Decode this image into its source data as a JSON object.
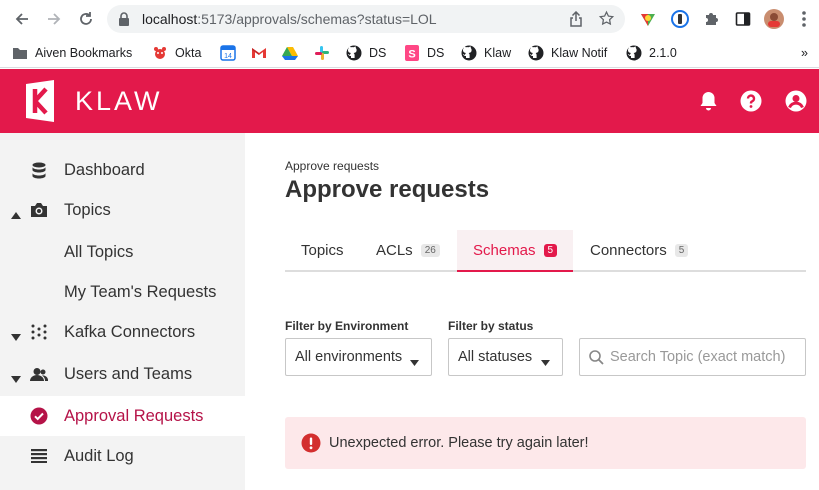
{
  "browser": {
    "url_host": "localhost",
    "url_rest": ":5173/approvals/schemas?status=LOL"
  },
  "bookmarks": [
    {
      "label": "Aiven Bookmarks",
      "icon": "folder-icon"
    },
    {
      "label": "Okta",
      "icon": "okta-icon"
    },
    {
      "label": "",
      "icon": "calendar-icon"
    },
    {
      "label": "",
      "icon": "gmail-icon"
    },
    {
      "label": "",
      "icon": "drive-icon"
    },
    {
      "label": "",
      "icon": "slack-icon"
    },
    {
      "label": "DS",
      "icon": "github-icon"
    },
    {
      "label": "DS",
      "icon": "storybook-icon"
    },
    {
      "label": "Klaw",
      "icon": "github-icon"
    },
    {
      "label": "Klaw Notif",
      "icon": "github-icon"
    },
    {
      "label": "2.1.0",
      "icon": "github-icon"
    }
  ],
  "bookmarks_more": "»",
  "header": {
    "logo_text": "KLAW",
    "brand_color": "#e3194b"
  },
  "sidebar": {
    "items": [
      {
        "label": "Dashboard",
        "icon": "database-icon"
      },
      {
        "label": "Topics",
        "icon": "topics-icon",
        "expanded": true
      },
      {
        "label": "All Topics"
      },
      {
        "label": "My Team's Requests"
      },
      {
        "label": "Kafka Connectors",
        "icon": "connectors-icon",
        "expanded": false
      },
      {
        "label": "Users and Teams",
        "icon": "users-icon",
        "expanded": false
      },
      {
        "label": "Approval Requests",
        "icon": "check-circle-icon",
        "active": true
      },
      {
        "label": "Audit Log",
        "icon": "list-icon"
      }
    ]
  },
  "main": {
    "breadcrumb": "Approve requests",
    "title": "Approve requests",
    "tabs": [
      {
        "label": "Topics",
        "badge": ""
      },
      {
        "label": "ACLs",
        "badge": "26"
      },
      {
        "label": "Schemas",
        "badge": "5",
        "active": true
      },
      {
        "label": "Connectors",
        "badge": "5"
      }
    ],
    "filters": {
      "env_label": "Filter by Environment",
      "env_value": "All environments",
      "status_label": "Filter by status",
      "status_value": "All statuses",
      "search_placeholder": "Search Topic (exact match)"
    },
    "alert": {
      "message": "Unexpected error. Please try again later!"
    }
  }
}
